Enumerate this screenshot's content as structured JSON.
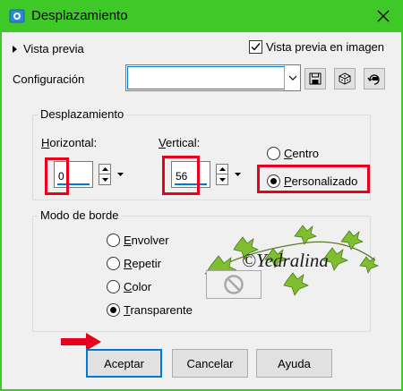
{
  "window": {
    "title": "Desplazamiento"
  },
  "top": {
    "preview_toggle_label": "Vista previa",
    "preview_in_image_label": "Vista previa en imagen",
    "preview_in_image_checked": true,
    "config_label": "Configuración",
    "config_value": ""
  },
  "offset_group": {
    "title": "Desplazamiento",
    "horizontal_label_prefix": "H",
    "horizontal_label_rest": "orizontal:",
    "horizontal_value": "0",
    "vertical_label_prefix": "V",
    "vertical_label_rest": "ertical:",
    "vertical_value": "56",
    "center_label_prefix": "C",
    "center_label_rest": "entro",
    "custom_label_prefix": "P",
    "custom_label_rest": "ersonalizado",
    "selected": "custom"
  },
  "edge_group": {
    "title": "Modo de borde",
    "options": [
      {
        "prefix": "E",
        "rest": "nvolver"
      },
      {
        "prefix": "R",
        "rest": "epetir"
      },
      {
        "prefix": "C",
        "rest": "olor"
      },
      {
        "prefix": "T",
        "rest": "ransparente"
      }
    ],
    "selected": "transparent"
  },
  "watermark_text": "©Yedralina",
  "buttons": {
    "accept": "Aceptar",
    "cancel": "Cancelar",
    "help": "Ayuda"
  },
  "colors": {
    "titlebar": "#3fc928",
    "highlight_red": "#e8001c",
    "focus_blue": "#0078d7"
  }
}
